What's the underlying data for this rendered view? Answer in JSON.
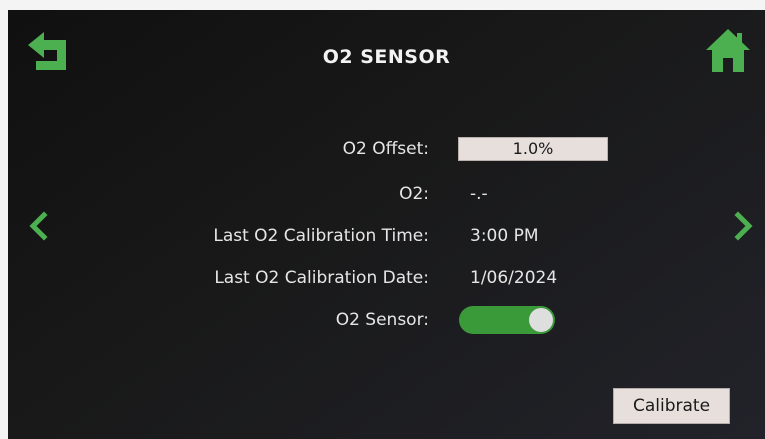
{
  "header": {
    "title": "O2 SENSOR",
    "back_icon": "back-arrow-icon",
    "home_icon": "home-icon"
  },
  "navigation": {
    "prev_icon": "chevron-left-icon",
    "next_icon": "chevron-right-icon"
  },
  "settings": {
    "offset_label": "O2 Offset:",
    "offset_value": "1.0%",
    "o2_label": "O2:",
    "o2_value": "-.-",
    "cal_time_label": "Last O2 Calibration Time:",
    "cal_time_value": "3:00 PM",
    "cal_date_label": "Last O2 Calibration Date:",
    "cal_date_value": "1/06/2024",
    "sensor_label": "O2 Sensor:",
    "sensor_enabled": true
  },
  "actions": {
    "calibrate_label": "Calibrate"
  },
  "colors": {
    "accent_green": "#3a9a3a",
    "icon_green": "#4caf50",
    "background": "#141414",
    "field_background": "#e7dfdc"
  }
}
